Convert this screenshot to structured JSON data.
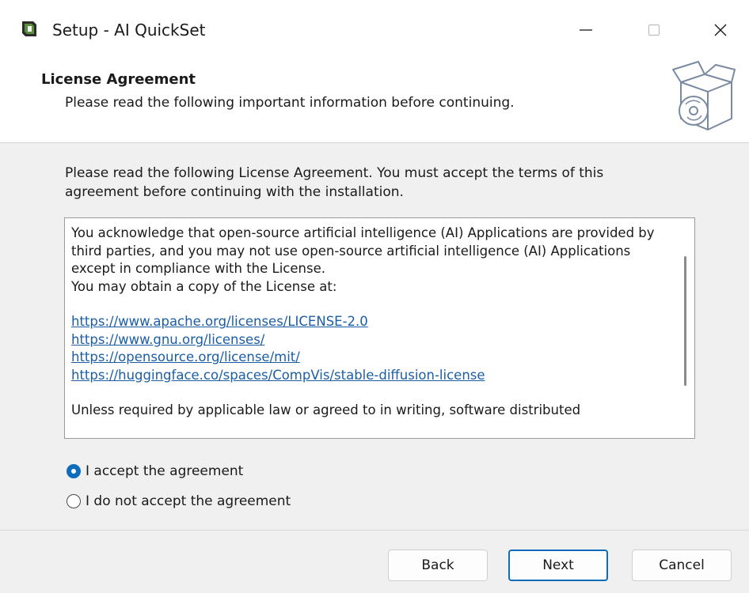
{
  "window": {
    "title": "Setup - AI QuickSet",
    "controls": {
      "minimize_icon": "minimize-icon",
      "maximize_icon": "maximize-icon",
      "close_icon": "close-icon"
    }
  },
  "header": {
    "title": "License Agreement",
    "subtitle": "Please read the following important information before continuing.",
    "icon": "setup-box-cd-icon"
  },
  "body": {
    "intro": "Please read the following License Agreement. You must accept the terms of this agreement before continuing with the installation.",
    "license": {
      "para1": "You acknowledge that open-source artificial intelligence (AI) Applications are provided by third parties, and you may not use open-source artificial intelligence (AI) Applications except in compliance with the License.",
      "para2": "You may obtain a copy of the License at:",
      "links": [
        "https://www.apache.org/licenses/LICENSE-2.0",
        "https://www.gnu.org/licenses/",
        "https://opensource.org/license/mit/",
        "https://huggingface.co/spaces/CompVis/stable-diffusion-license"
      ],
      "para3": "Unless required by applicable law or agreed to in writing, software distributed"
    },
    "options": {
      "accept": "I accept the agreement",
      "decline": "I do not accept the agreement",
      "selected": "accept"
    }
  },
  "footer": {
    "back": "Back",
    "next": "Next",
    "cancel": "Cancel"
  },
  "colors": {
    "accent": "#0f6cbd",
    "link": "#1b5ea6",
    "body_bg": "#f0f0f0"
  }
}
